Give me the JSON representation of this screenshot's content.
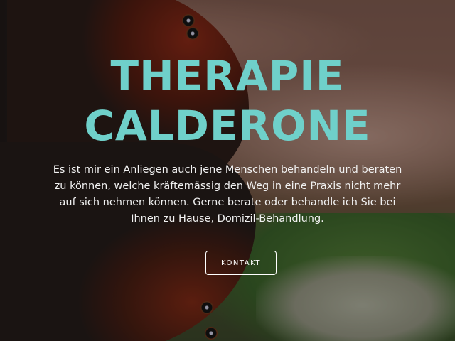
{
  "hero": {
    "title_line1": "THERAPIE",
    "title_line2": "CALDERONE",
    "text": "Es ist mir ein Anliegen auch jene Menschen behandeln und beraten zu können, welche kräftemässig den Weg in eine Praxis nicht mehr auf sich nehmen können. Gerne berate oder behandle ich Sie bei Ihnen zu Hause, Domizil-Behandlung.",
    "button_label": "KONTAKT"
  },
  "colors": {
    "title": "#6fd0ca",
    "text": "#f1f1f1",
    "button_border": "#ffffff"
  }
}
